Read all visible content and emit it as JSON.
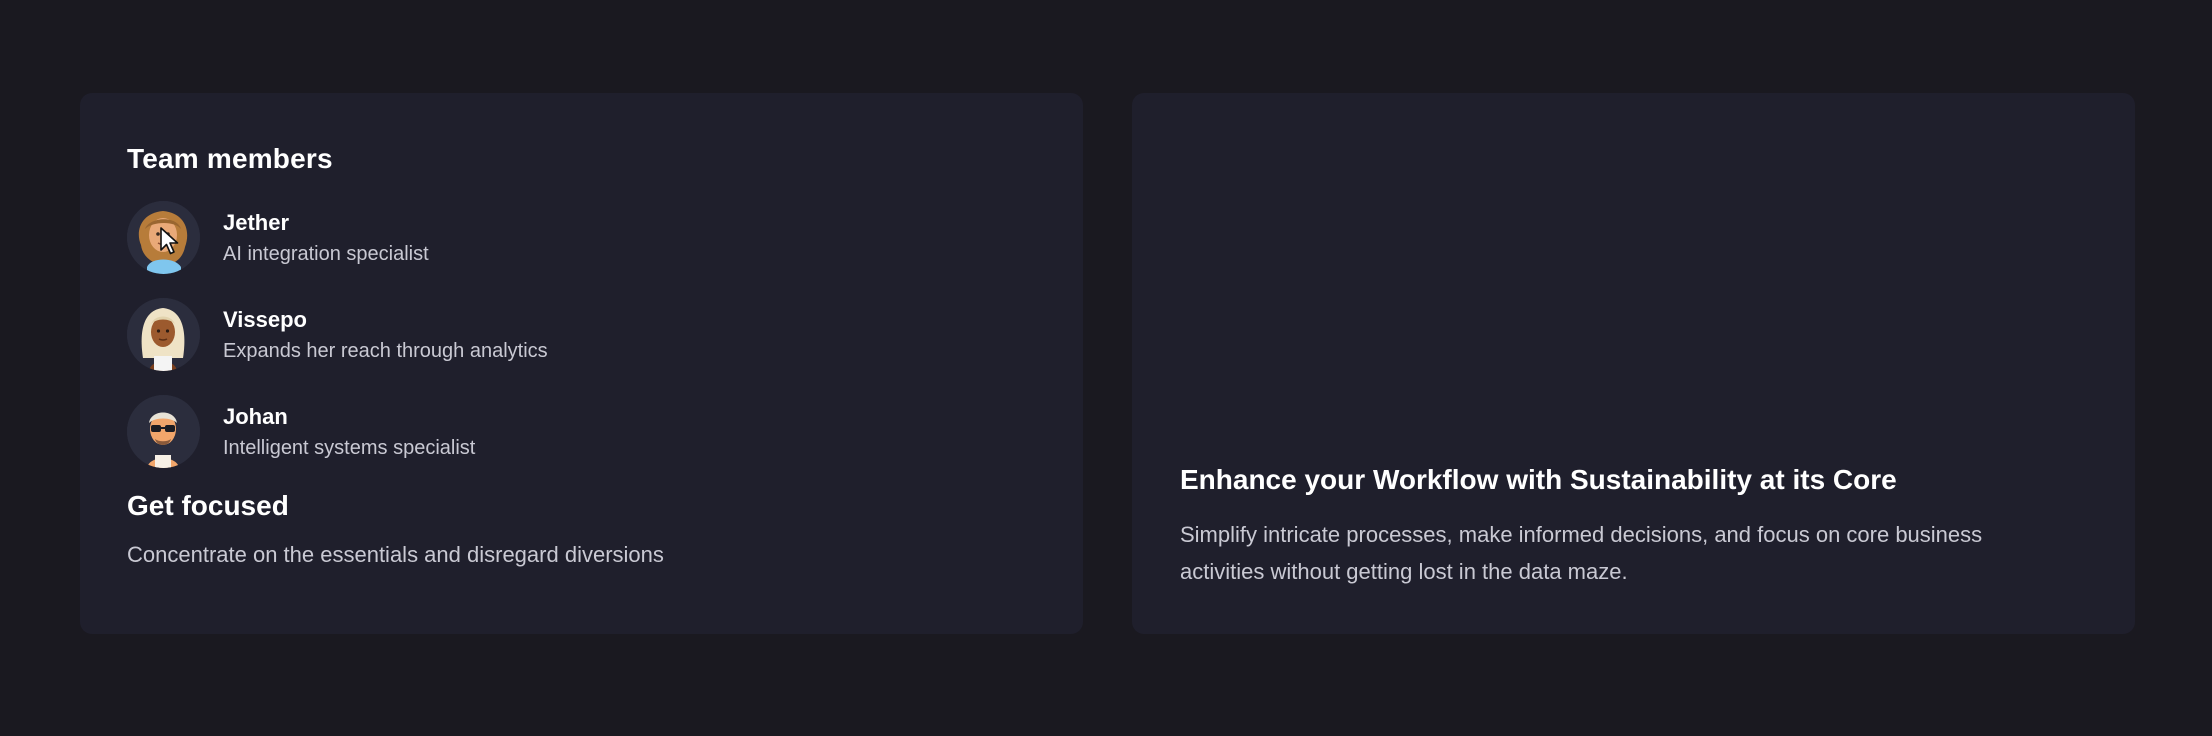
{
  "team": {
    "title": "Team members",
    "members": [
      {
        "name": "Jether",
        "role": "AI integration specialist",
        "avatar_icon": "avatar-curly-hair-icon"
      },
      {
        "name": "Vissepo",
        "role": "Expands her reach through analytics",
        "avatar_icon": "avatar-long-blonde-hair-icon"
      },
      {
        "name": "Johan",
        "role": "Intelligent systems specialist",
        "avatar_icon": "avatar-sunglasses-icon"
      }
    ]
  },
  "focus": {
    "title": "Get focused",
    "text": "Concentrate on the essentials and disregard diversions"
  },
  "feature": {
    "title": "Enhance your Workflow with Sustainability at its Core",
    "text": "Simplify intricate processes, make informed decisions, and focus on core business activities without getting lost in the data maze."
  },
  "colors": {
    "background": "#1a1920",
    "card": "#1f1f2c",
    "heading": "#ffffff",
    "body_text": "#c9c9d3"
  }
}
